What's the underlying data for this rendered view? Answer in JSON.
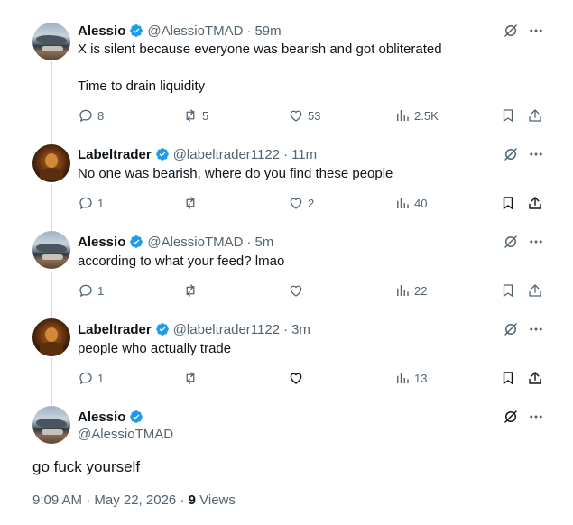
{
  "colors": {
    "verified": "#1d9bf0",
    "muted": "#536471",
    "text": "#0f1419",
    "line": "#cfd9de"
  },
  "tweets": [
    {
      "name": "Alessio",
      "handle": "@AlessioTMAD",
      "time": "59m",
      "lines": [
        "X is silent because everyone was bearish and got obliterated",
        "",
        "Time to drain liquidity"
      ],
      "replies": "8",
      "reposts": "5",
      "likes": "53",
      "views": "2.5K"
    },
    {
      "name": "Labeltrader",
      "handle": "@labeltrader1122",
      "time": "11m",
      "lines": [
        "No one was bearish, where do you find these people"
      ],
      "replies": "1",
      "reposts": "",
      "likes": "2",
      "views": "40"
    },
    {
      "name": "Alessio",
      "handle": "@AlessioTMAD",
      "time": "5m",
      "lines": [
        "according to what your feed? lmao"
      ],
      "replies": "1",
      "reposts": "",
      "likes": "",
      "views": "22"
    },
    {
      "name": "Labeltrader",
      "handle": "@labeltrader1122",
      "time": "3m",
      "lines": [
        "people who actually trade"
      ],
      "replies": "1",
      "reposts": "",
      "likes": "",
      "views": "13"
    }
  ],
  "focus": {
    "name": "Alessio",
    "handle": "@AlessioTMAD",
    "text": "go fuck yourself",
    "time": "9:09 AM · May 22, 2026",
    "views_count": "9",
    "views_label": "Views"
  },
  "icons": [
    "verified-badge-icon",
    "grok-icon",
    "more-icon",
    "reply-icon",
    "repost-icon",
    "like-icon",
    "views-icon",
    "bookmark-icon",
    "share-icon"
  ]
}
